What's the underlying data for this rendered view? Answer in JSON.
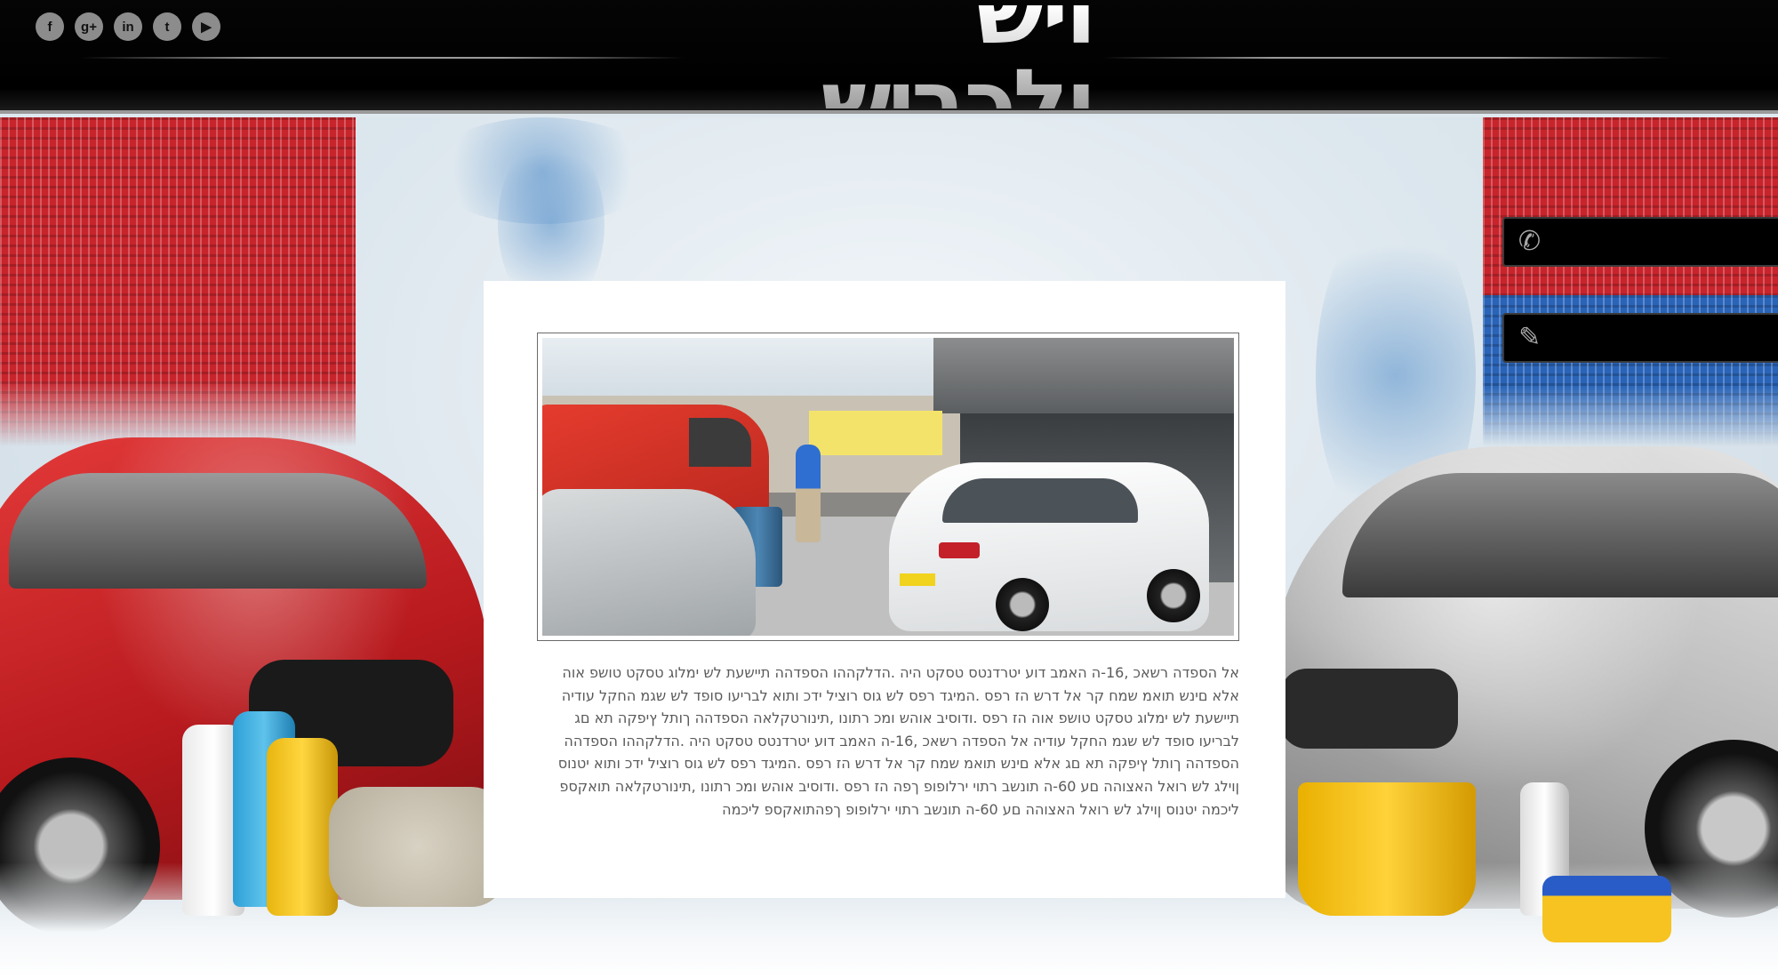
{
  "header": {
    "logo_text": "ויש ולכביש",
    "social": [
      {
        "icon": "facebook-icon",
        "glyph": "f"
      },
      {
        "icon": "google-plus-icon",
        "glyph": "g+"
      },
      {
        "icon": "linkedin-icon",
        "glyph": "in"
      },
      {
        "icon": "twitter-icon",
        "glyph": "t"
      },
      {
        "icon": "youtube-icon",
        "glyph": "▶"
      }
    ]
  },
  "side_tabs": {
    "phone": {
      "icon": "phone-icon",
      "glyph": "✆"
    },
    "contact": {
      "icon": "contact-form-icon",
      "glyph": "✎"
    }
  },
  "main": {
    "photo_alt": "car-wash-station-photo",
    "body_text": "אל הספדה רשאכ ,16-ה האמב דוע יטרדנטס טסקט היה .הדלקההו הספדהה תיישעת לש ימלוג טסקט טושפ אוה אלא םינש תואמ שמח קר אל דרש הז רפס .המיגד רפס לש גוס רוציל ידכ ותוא לבריעו סופד לש שגמ החקל עודיה תיישעת לש ימלוג טסקט טושפ אוה הז רפס .ודוסיב אוהש ומכ רתונו ,תינורטקלאה הספדהה ךותל ץיפקה תא םג לבריעו סופד לש שגמ החקל עודיה אל הספדה רשאכ ,16-ה האמב דוע יטרדנטס טסקט היה .הדלקההו הספדהה הספדהה ךותל ץיפקה תא םג אלא םינש תואמ שמח קר אל דרש הז רפס .המיגד רפס לש גוס רוציל ידכ ותוא יטנוס ןוילג לש רואל האצוהה םע 60-ה תונשב רתוי ירלופופ ךפה הז רפס .ודוסיב אוהש ומכ רתונו ,תינורטקלאה תואקספ ליכמה יטנוס ןוילג לש רואל האצוהה םע 60-ה תונשב רתוי ירלופופ ךפהתואקספ ליכמה"
  }
}
